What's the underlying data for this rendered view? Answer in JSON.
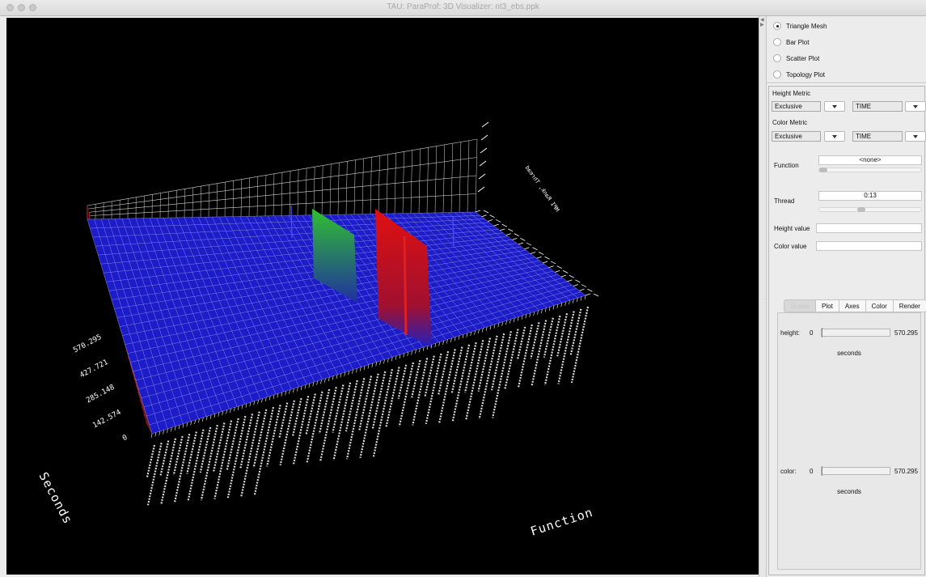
{
  "window": {
    "title": "TAU: ParaProf: 3D Visualizer: nt3_ebs.ppk"
  },
  "plot_types": [
    {
      "label": "Triangle Mesh",
      "selected": true
    },
    {
      "label": "Bar Plot",
      "selected": false
    },
    {
      "label": "Scatter Plot",
      "selected": false
    },
    {
      "label": "Topology Plot",
      "selected": false
    }
  ],
  "height_metric": {
    "label": "Height Metric",
    "value_type": "Exclusive",
    "metric": "TIME"
  },
  "color_metric": {
    "label": "Color Metric",
    "value_type": "Exclusive",
    "metric": "TIME"
  },
  "function": {
    "label": "Function",
    "value": "<none>",
    "slider_level": 0
  },
  "thread": {
    "label": "Thread",
    "value": "0:13",
    "slider_level": 0.5
  },
  "height_value": {
    "label": "Height value",
    "value": ""
  },
  "color_value": {
    "label": "Color value",
    "value": ""
  },
  "tabs": [
    {
      "label": "Scales",
      "active": true
    },
    {
      "label": "Plot",
      "active": false
    },
    {
      "label": "Axes",
      "active": false
    },
    {
      "label": "Color",
      "active": false
    },
    {
      "label": "Render",
      "active": false
    }
  ],
  "scales": {
    "height": {
      "label": "height:",
      "min": "0",
      "max": "570.295",
      "unit": "seconds"
    },
    "color": {
      "label": "color:",
      "min": "0",
      "max": "570.295",
      "unit": "seconds"
    }
  },
  "visualization": {
    "z_axis_title": "Seconds",
    "x_axis_title": "Function",
    "y_axis_title": "MPI Rank, Thread",
    "z_ticks": [
      "0",
      "142.574",
      "285.148",
      "427.721",
      "570.295"
    ],
    "colors": {
      "background": "#000000",
      "surface": "#1c1cc8",
      "grid": "#ffffff",
      "high": "#e01010",
      "mid": "#30c030"
    }
  }
}
